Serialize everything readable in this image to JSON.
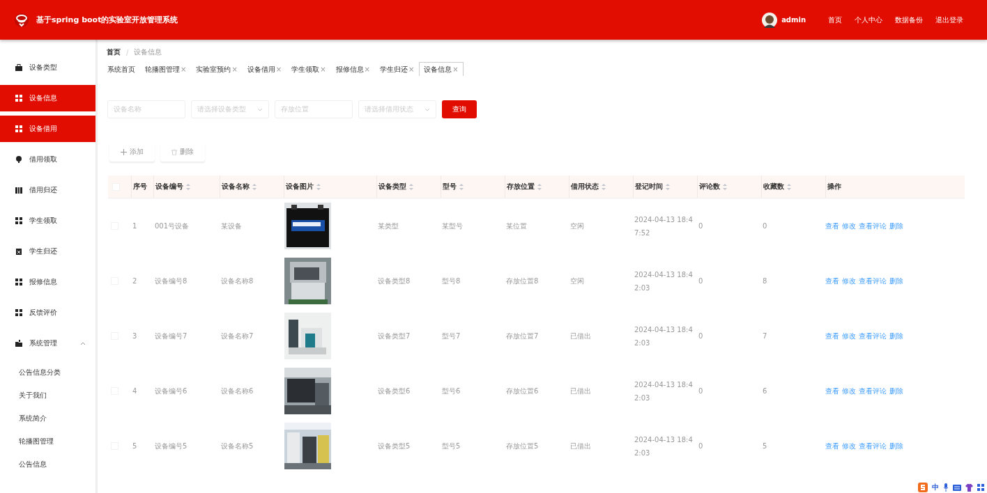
{
  "header": {
    "title": "基于spring boot的实验室开放管理系统",
    "user": "admin",
    "links": [
      "首页",
      "个人中心",
      "数据备份",
      "退出登录"
    ]
  },
  "sidebar": {
    "items": [
      {
        "label": "设备类型",
        "selected": false
      },
      {
        "label": "设备信息",
        "selected": true
      },
      {
        "label": "设备借用",
        "selected": true
      },
      {
        "label": "借用领取",
        "selected": false
      },
      {
        "label": "借用归还",
        "selected": false
      },
      {
        "label": "学生领取",
        "selected": false
      },
      {
        "label": "学生归还",
        "selected": false
      },
      {
        "label": "报修信息",
        "selected": false
      },
      {
        "label": "反馈评价",
        "selected": false
      },
      {
        "label": "系统管理",
        "selected": false,
        "expanded": true,
        "children": [
          {
            "label": "公告信息分类"
          },
          {
            "label": "关于我们"
          },
          {
            "label": "系统简介"
          },
          {
            "label": "轮播图管理"
          },
          {
            "label": "公告信息"
          }
        ]
      }
    ]
  },
  "breadcrumb": [
    "首页",
    "设备信息"
  ],
  "breadcrumb_separator": "/",
  "tabs": [
    {
      "label": "系统首页",
      "closable": false,
      "selected": false
    },
    {
      "label": "轮播图管理",
      "closable": true,
      "selected": false
    },
    {
      "label": "实验室预约",
      "closable": true,
      "selected": false
    },
    {
      "label": "设备借用",
      "closable": true,
      "selected": false
    },
    {
      "label": "学生领取",
      "closable": true,
      "selected": false
    },
    {
      "label": "报修信息",
      "closable": true,
      "selected": false
    },
    {
      "label": "学生归还",
      "closable": true,
      "selected": false
    },
    {
      "label": "设备信息",
      "closable": true,
      "selected": true
    }
  ],
  "close_mark": "×",
  "filters": [
    {
      "kind": "input",
      "placeholder": "设备名称"
    },
    {
      "kind": "select",
      "placeholder": "请选择设备类型"
    },
    {
      "kind": "input",
      "placeholder": "存放位置"
    },
    {
      "kind": "select",
      "placeholder": "请选择借用状态"
    }
  ],
  "search_button": "查询",
  "actions": [
    {
      "label": "添加",
      "kind": "add"
    },
    {
      "label": "删除",
      "kind": "delete"
    }
  ],
  "table": {
    "select_all": false,
    "columns": [
      {
        "label": "序号",
        "sortable": false
      },
      {
        "label": "设备编号",
        "sortable": true
      },
      {
        "label": "设备名称",
        "sortable": true
      },
      {
        "label": "设备图片",
        "sortable": true
      },
      {
        "label": "设备类型",
        "sortable": true
      },
      {
        "label": "型号",
        "sortable": true
      },
      {
        "label": "存放位置",
        "sortable": true
      },
      {
        "label": "借用状态",
        "sortable": true
      },
      {
        "label": "登记时间",
        "sortable": true
      },
      {
        "label": "评论数",
        "sortable": true
      },
      {
        "label": "收藏数",
        "sortable": true
      },
      {
        "label": "操作",
        "sortable": false
      }
    ],
    "rows": [
      {
        "checked": false,
        "cells": [
          "1",
          "001号设备",
          "某设备",
          "",
          "某类型",
          "某型号",
          "某位置",
          "空闲",
          "2024-04-13 18:47:52",
          "0",
          "0"
        ],
        "ops": [
          "查看",
          "修改",
          "查看评论",
          "删除"
        ]
      },
      {
        "checked": false,
        "cells": [
          "2",
          "设备编号8",
          "设备名称8",
          "",
          "设备类型8",
          "型号8",
          "存放位置8",
          "空闲",
          "2024-04-13 18:42:03",
          "0",
          "8"
        ],
        "ops": [
          "查看",
          "修改",
          "查看评论",
          "删除"
        ]
      },
      {
        "checked": false,
        "cells": [
          "3",
          "设备编号7",
          "设备名称7",
          "",
          "设备类型7",
          "型号7",
          "存放位置7",
          "已借出",
          "2024-04-13 18:42:03",
          "0",
          "7"
        ],
        "ops": [
          "查看",
          "修改",
          "查看评论",
          "删除"
        ]
      },
      {
        "checked": false,
        "cells": [
          "4",
          "设备编号6",
          "设备名称6",
          "",
          "设备类型6",
          "型号6",
          "存放位置6",
          "已借出",
          "2024-04-13 18:42:03",
          "0",
          "6"
        ],
        "ops": [
          "查看",
          "修改",
          "查看评论",
          "删除"
        ]
      },
      {
        "checked": false,
        "cells": [
          "5",
          "设备编号5",
          "设备名称5",
          "",
          "设备类型5",
          "型号5",
          "存放位置5",
          "已借出",
          "2024-04-13 18:42:03",
          "0",
          "5"
        ],
        "ops": [
          "查看",
          "修改",
          "查看评论",
          "删除"
        ]
      }
    ]
  },
  "ime_bar": {
    "mode": "中"
  }
}
